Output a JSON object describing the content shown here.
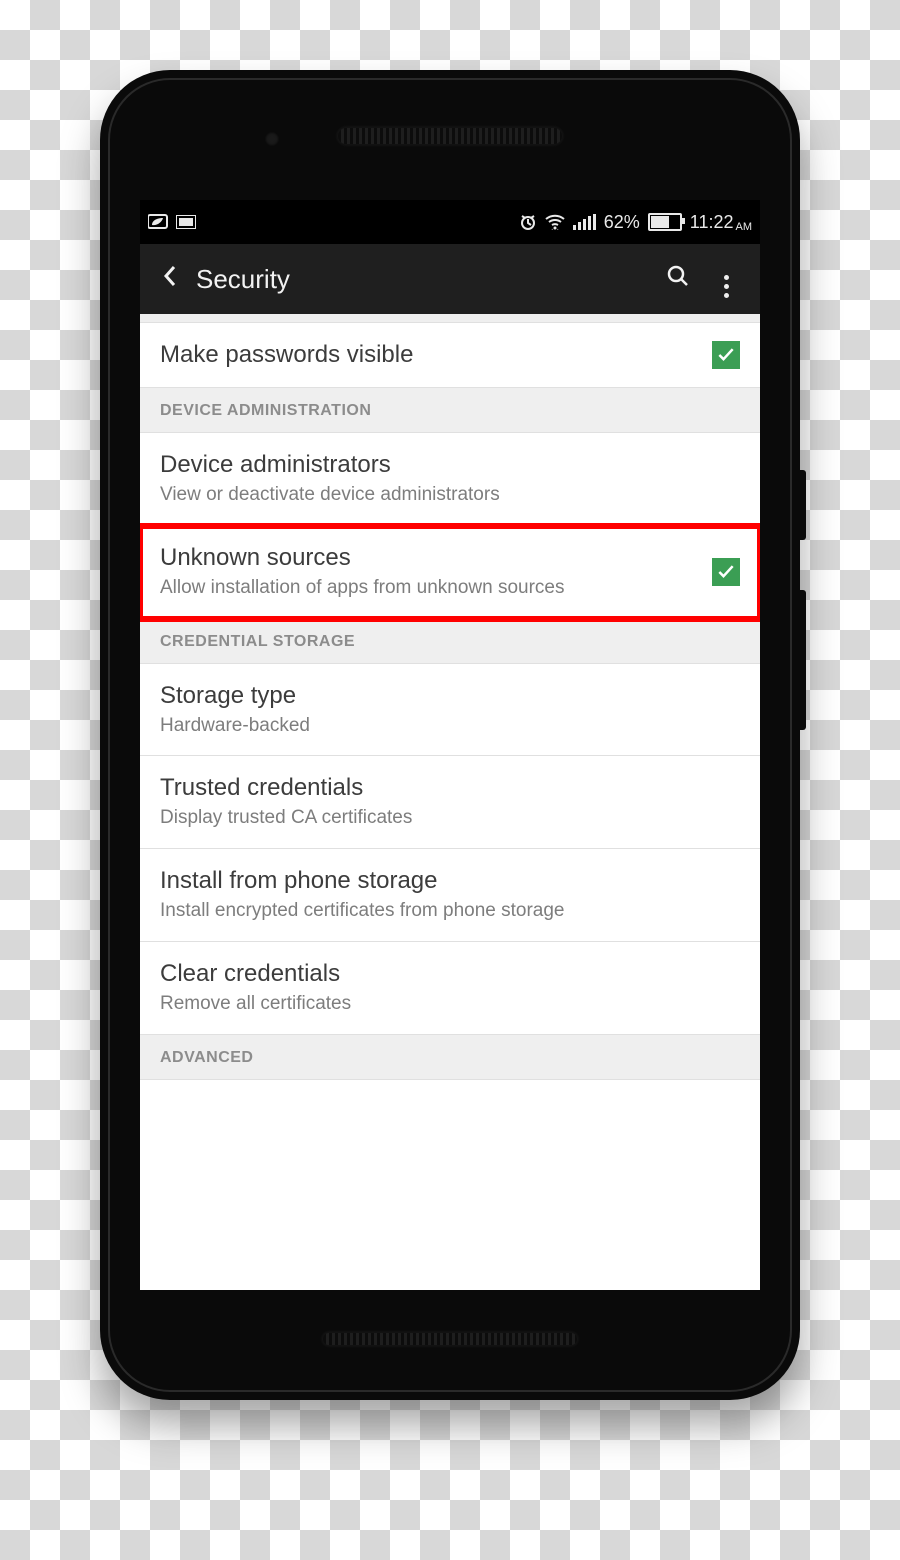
{
  "statusbar": {
    "battery_percent": "62%",
    "battery_fill": 60,
    "time": "11:22",
    "ampm": "AM"
  },
  "titlebar": {
    "title": "Security"
  },
  "rows": {
    "passwords": {
      "title": "Make passwords visible",
      "checked": true
    },
    "section_device": "DEVICE ADMINISTRATION",
    "device_admins": {
      "title": "Device administrators",
      "sub": "View or deactivate device administrators"
    },
    "unknown": {
      "title": "Unknown sources",
      "sub": "Allow installation of apps from unknown sources",
      "checked": true,
      "highlighted": true
    },
    "section_cred": "CREDENTIAL STORAGE",
    "storage": {
      "title": "Storage type",
      "sub": "Hardware-backed"
    },
    "trusted": {
      "title": "Trusted credentials",
      "sub": "Display trusted CA certificates"
    },
    "install": {
      "title": "Install from phone storage",
      "sub": "Install encrypted certificates from phone storage"
    },
    "clear": {
      "title": "Clear credentials",
      "sub": "Remove all certificates"
    },
    "section_adv": "ADVANCED"
  },
  "colors": {
    "accent": "#3b9e54",
    "highlight": "#ff0000"
  }
}
